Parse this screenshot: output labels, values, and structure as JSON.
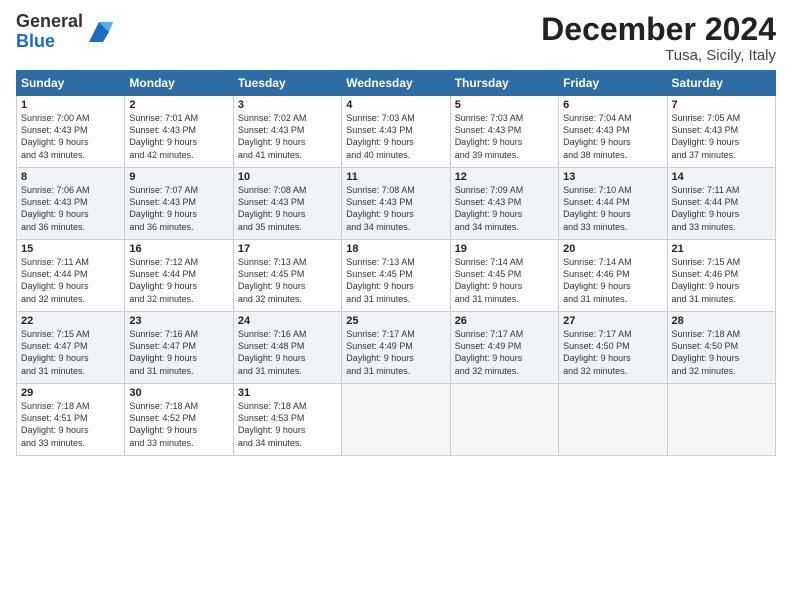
{
  "header": {
    "logo_line1": "General",
    "logo_line2": "Blue",
    "month_title": "December 2024",
    "location": "Tusa, Sicily, Italy"
  },
  "days_of_week": [
    "Sunday",
    "Monday",
    "Tuesday",
    "Wednesday",
    "Thursday",
    "Friday",
    "Saturday"
  ],
  "weeks": [
    [
      {
        "day": "1",
        "sunrise": "7:00 AM",
        "sunset": "4:43 PM",
        "daylight": "9 hours and 43 minutes."
      },
      {
        "day": "2",
        "sunrise": "7:01 AM",
        "sunset": "4:43 PM",
        "daylight": "9 hours and 42 minutes."
      },
      {
        "day": "3",
        "sunrise": "7:02 AM",
        "sunset": "4:43 PM",
        "daylight": "9 hours and 41 minutes."
      },
      {
        "day": "4",
        "sunrise": "7:03 AM",
        "sunset": "4:43 PM",
        "daylight": "9 hours and 40 minutes."
      },
      {
        "day": "5",
        "sunrise": "7:03 AM",
        "sunset": "4:43 PM",
        "daylight": "9 hours and 39 minutes."
      },
      {
        "day": "6",
        "sunrise": "7:04 AM",
        "sunset": "4:43 PM",
        "daylight": "9 hours and 38 minutes."
      },
      {
        "day": "7",
        "sunrise": "7:05 AM",
        "sunset": "4:43 PM",
        "daylight": "9 hours and 37 minutes."
      }
    ],
    [
      {
        "day": "8",
        "sunrise": "7:06 AM",
        "sunset": "4:43 PM",
        "daylight": "9 hours and 36 minutes."
      },
      {
        "day": "9",
        "sunrise": "7:07 AM",
        "sunset": "4:43 PM",
        "daylight": "9 hours and 36 minutes."
      },
      {
        "day": "10",
        "sunrise": "7:08 AM",
        "sunset": "4:43 PM",
        "daylight": "9 hours and 35 minutes."
      },
      {
        "day": "11",
        "sunrise": "7:08 AM",
        "sunset": "4:43 PM",
        "daylight": "9 hours and 34 minutes."
      },
      {
        "day": "12",
        "sunrise": "7:09 AM",
        "sunset": "4:43 PM",
        "daylight": "9 hours and 34 minutes."
      },
      {
        "day": "13",
        "sunrise": "7:10 AM",
        "sunset": "4:44 PM",
        "daylight": "9 hours and 33 minutes."
      },
      {
        "day": "14",
        "sunrise": "7:11 AM",
        "sunset": "4:44 PM",
        "daylight": "9 hours and 33 minutes."
      }
    ],
    [
      {
        "day": "15",
        "sunrise": "7:11 AM",
        "sunset": "4:44 PM",
        "daylight": "9 hours and 32 minutes."
      },
      {
        "day": "16",
        "sunrise": "7:12 AM",
        "sunset": "4:44 PM",
        "daylight": "9 hours and 32 minutes."
      },
      {
        "day": "17",
        "sunrise": "7:13 AM",
        "sunset": "4:45 PM",
        "daylight": "9 hours and 32 minutes."
      },
      {
        "day": "18",
        "sunrise": "7:13 AM",
        "sunset": "4:45 PM",
        "daylight": "9 hours and 31 minutes."
      },
      {
        "day": "19",
        "sunrise": "7:14 AM",
        "sunset": "4:45 PM",
        "daylight": "9 hours and 31 minutes."
      },
      {
        "day": "20",
        "sunrise": "7:14 AM",
        "sunset": "4:46 PM",
        "daylight": "9 hours and 31 minutes."
      },
      {
        "day": "21",
        "sunrise": "7:15 AM",
        "sunset": "4:46 PM",
        "daylight": "9 hours and 31 minutes."
      }
    ],
    [
      {
        "day": "22",
        "sunrise": "7:15 AM",
        "sunset": "4:47 PM",
        "daylight": "9 hours and 31 minutes."
      },
      {
        "day": "23",
        "sunrise": "7:16 AM",
        "sunset": "4:47 PM",
        "daylight": "9 hours and 31 minutes."
      },
      {
        "day": "24",
        "sunrise": "7:16 AM",
        "sunset": "4:48 PM",
        "daylight": "9 hours and 31 minutes."
      },
      {
        "day": "25",
        "sunrise": "7:17 AM",
        "sunset": "4:49 PM",
        "daylight": "9 hours and 31 minutes."
      },
      {
        "day": "26",
        "sunrise": "7:17 AM",
        "sunset": "4:49 PM",
        "daylight": "9 hours and 32 minutes."
      },
      {
        "day": "27",
        "sunrise": "7:17 AM",
        "sunset": "4:50 PM",
        "daylight": "9 hours and 32 minutes."
      },
      {
        "day": "28",
        "sunrise": "7:18 AM",
        "sunset": "4:50 PM",
        "daylight": "9 hours and 32 minutes."
      }
    ],
    [
      {
        "day": "29",
        "sunrise": "7:18 AM",
        "sunset": "4:51 PM",
        "daylight": "9 hours and 33 minutes."
      },
      {
        "day": "30",
        "sunrise": "7:18 AM",
        "sunset": "4:52 PM",
        "daylight": "9 hours and 33 minutes."
      },
      {
        "day": "31",
        "sunrise": "7:18 AM",
        "sunset": "4:53 PM",
        "daylight": "9 hours and 34 minutes."
      },
      null,
      null,
      null,
      null
    ]
  ]
}
